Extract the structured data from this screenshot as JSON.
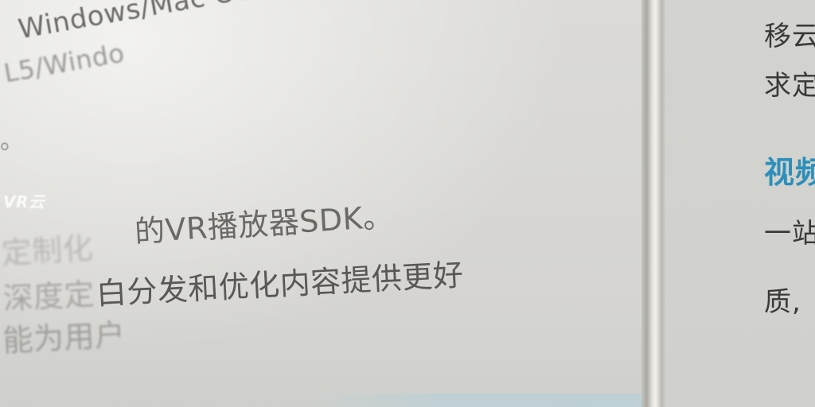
{
  "left_page": {
    "os_line": "Windows/Mac OS/Gear V",
    "l5_line": "L5/Windo",
    "dot_line": "。",
    "logo_text": "VR云",
    "sdk_line_faded": "定制化",
    "sdk_line": "的VR播放器SDK。",
    "content_line_faded": "深度定",
    "content_line": "白分发和优化内容提供更好",
    "user_line": "能为用户"
  },
  "right_page": {
    "line1": "移云",
    "line2": "求定",
    "heading": "视频",
    "line4": "一站",
    "line5": "质,"
  }
}
